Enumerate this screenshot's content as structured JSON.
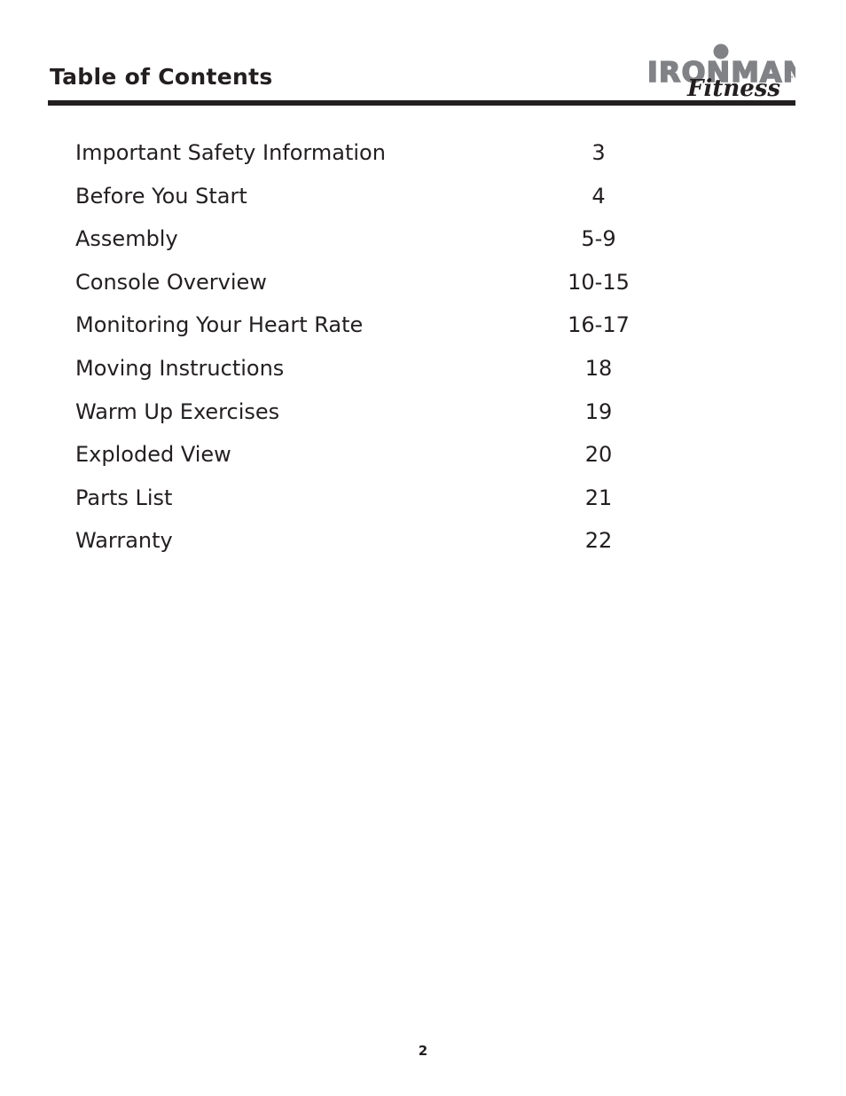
{
  "document": {
    "title": "Table of Contents",
    "page_number": "2"
  },
  "logo": {
    "wordmark": "IRONMAN",
    "script": "Fitness",
    "trademark": "™",
    "wordmark_color": "#808285",
    "script_color": "#231f20"
  },
  "toc": {
    "entries": [
      {
        "label": "Important Safety Information",
        "page": "3"
      },
      {
        "label": "Before You Start",
        "page": "4"
      },
      {
        "label": "Assembly",
        "page": "5-9"
      },
      {
        "label": "Console Overview",
        "page": "10-15"
      },
      {
        "label": "Monitoring Your Heart Rate",
        "page": "16-17"
      },
      {
        "label": "Moving Instructions",
        "page": "18"
      },
      {
        "label": "Warm Up Exercises",
        "page": "19"
      },
      {
        "label": "Exploded View",
        "page": "20"
      },
      {
        "label": "Parts List",
        "page": "21"
      },
      {
        "label": "Warranty",
        "page": "22"
      }
    ]
  },
  "colors": {
    "text": "#231f20",
    "rule": "#231f20",
    "background": "#ffffff"
  }
}
